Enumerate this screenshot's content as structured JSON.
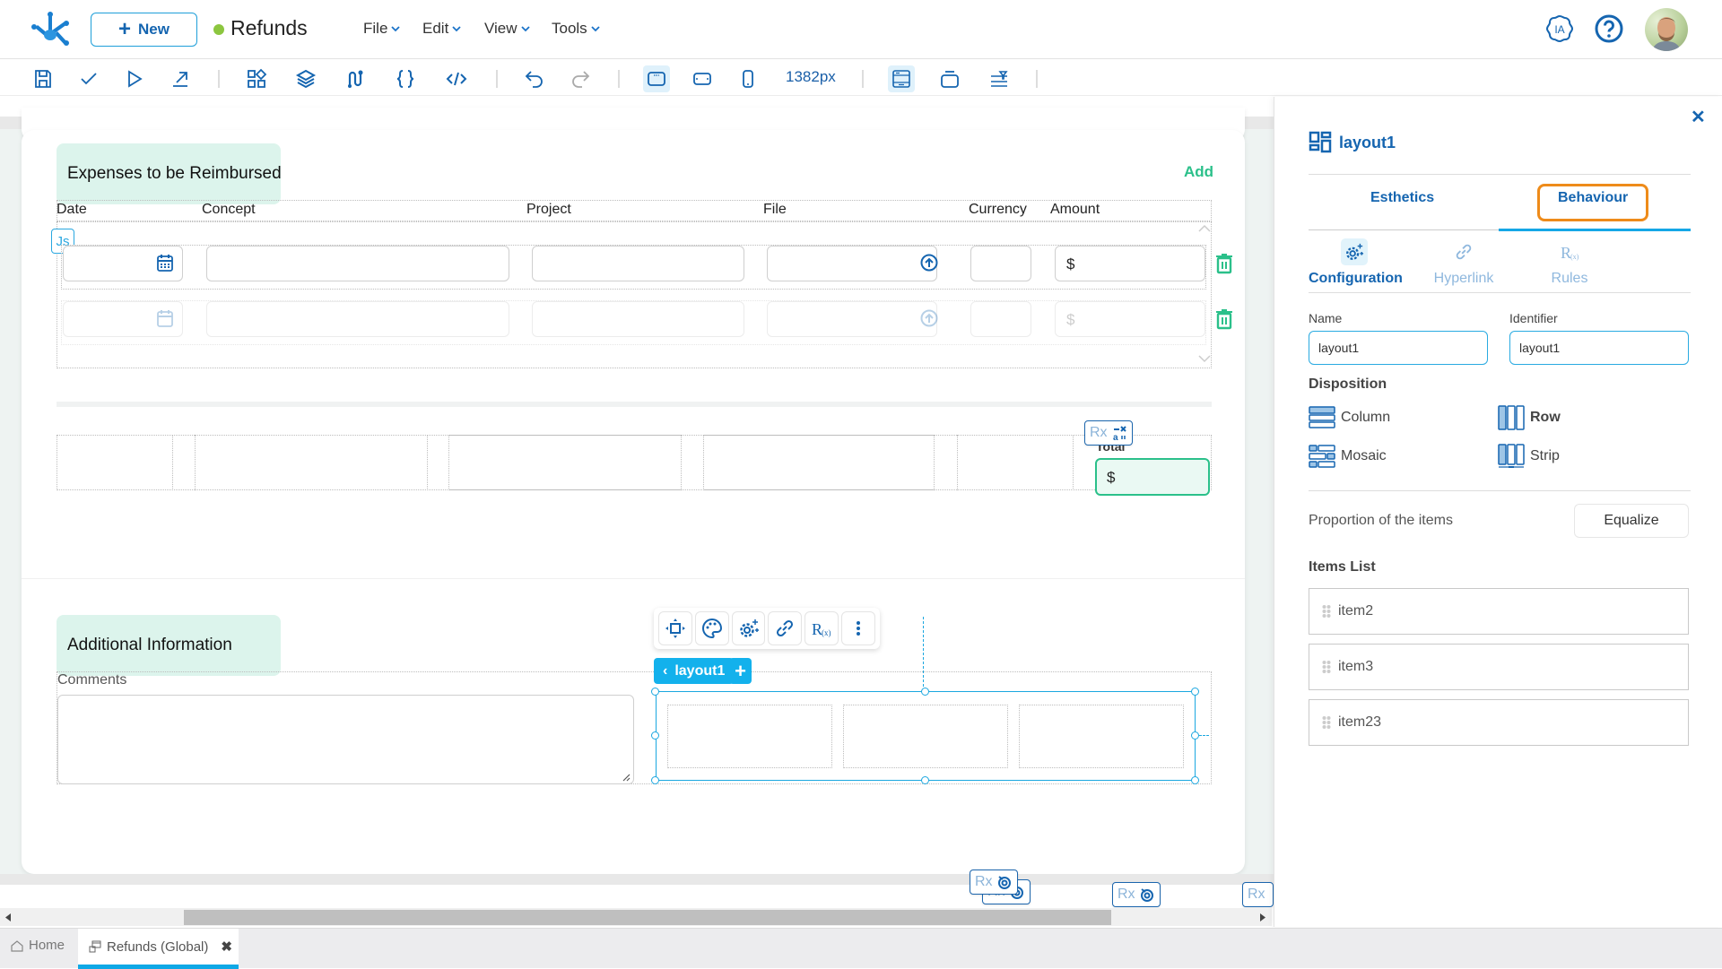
{
  "header": {
    "new_button": "New",
    "app_title": "Refunds",
    "status_color": "#8cc63f",
    "menus": [
      "File",
      "Edit",
      "View",
      "Tools"
    ],
    "ia_label": "IA"
  },
  "toolbar": {
    "width_readout": "1382px",
    "icons": [
      "save-icon",
      "check-icon",
      "play-icon",
      "export-icon",
      "components-icon",
      "layers-icon",
      "flow-icon",
      "braces-icon",
      "code-icon",
      "undo-icon",
      "redo-icon",
      "desktop-view-icon",
      "tablet-view-icon",
      "mobile-view-icon",
      "layout-frame-icon",
      "container-icon",
      "filter-icon"
    ],
    "active_view": "desktop"
  },
  "canvas": {
    "expenses": {
      "title": "Expenses to be Reimbursed",
      "add_label": "Add",
      "columns": [
        "Date",
        "Concept",
        "Project",
        "File",
        "Currency",
        "Amount"
      ],
      "rows": [
        {
          "amount_prefix": "$",
          "state": "active"
        },
        {
          "amount_prefix": "$",
          "state": "faded"
        }
      ],
      "js_badge": "Js",
      "total_label": "Total",
      "total_prefix": "$",
      "rx_badge": "Rx"
    },
    "additional": {
      "title": "Additional Information",
      "comments_label": "Comments"
    },
    "selected_layout": {
      "chip_label": "layout1",
      "add_symbol": "+"
    },
    "rule_badges": [
      "Rx",
      "Rx",
      "Rx",
      "Rx"
    ]
  },
  "panel": {
    "title": "layout1",
    "tabs": [
      "Esthetics",
      "Behaviour"
    ],
    "active_tab": "Behaviour",
    "subtabs": [
      "Configuration",
      "Hyperlink",
      "Rules"
    ],
    "active_subtab": "Configuration",
    "name_label": "Name",
    "name_value": "layout1",
    "identifier_label": "Identifier",
    "identifier_value": "layout1",
    "disposition_title": "Disposition",
    "disposition_options": [
      "Column",
      "Row",
      "Mosaic",
      "Strip"
    ],
    "disposition_selected": "Row",
    "proportion_label": "Proportion of the items",
    "equalize_label": "Equalize",
    "items_title": "Items List",
    "items": [
      "item2",
      "item3",
      "item23"
    ]
  },
  "bottom_tabs": {
    "home": "Home",
    "current": "Refunds (Global)"
  }
}
